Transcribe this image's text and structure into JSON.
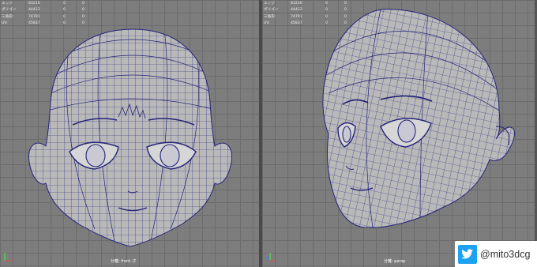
{
  "stats_labels": [
    "エッジ",
    "ポリゴン",
    "三角形:",
    "UV:"
  ],
  "left_viewport": {
    "stats": [
      {
        "v1": "83216",
        "v2": "0",
        "v3": "0"
      },
      {
        "v1": "44412",
        "v2": "0",
        "v3": "0"
      },
      {
        "v1": "74791",
        "v2": "0",
        "v3": "0"
      },
      {
        "v1": "45837",
        "v2": "0",
        "v3": "0"
      }
    ],
    "camera_label": "分離: front -Z"
  },
  "right_viewport": {
    "stats": [
      {
        "v1": "83216",
        "v2": "0",
        "v3": "0"
      },
      {
        "v1": "44412",
        "v2": "0",
        "v3": "0"
      },
      {
        "v1": "74791",
        "v2": "0",
        "v3": "0"
      },
      {
        "v1": "45837",
        "v2": "0",
        "v3": "0"
      }
    ],
    "camera_label": "分離: persp"
  },
  "badge": {
    "handle": "@mito3dcg",
    "icon": "twitter-bird-icon"
  },
  "colors": {
    "wire": "#23237a",
    "mesh": "#b9b9b9",
    "viewport_bg": "#7d7d7d",
    "twitter": "#1da1f2"
  }
}
